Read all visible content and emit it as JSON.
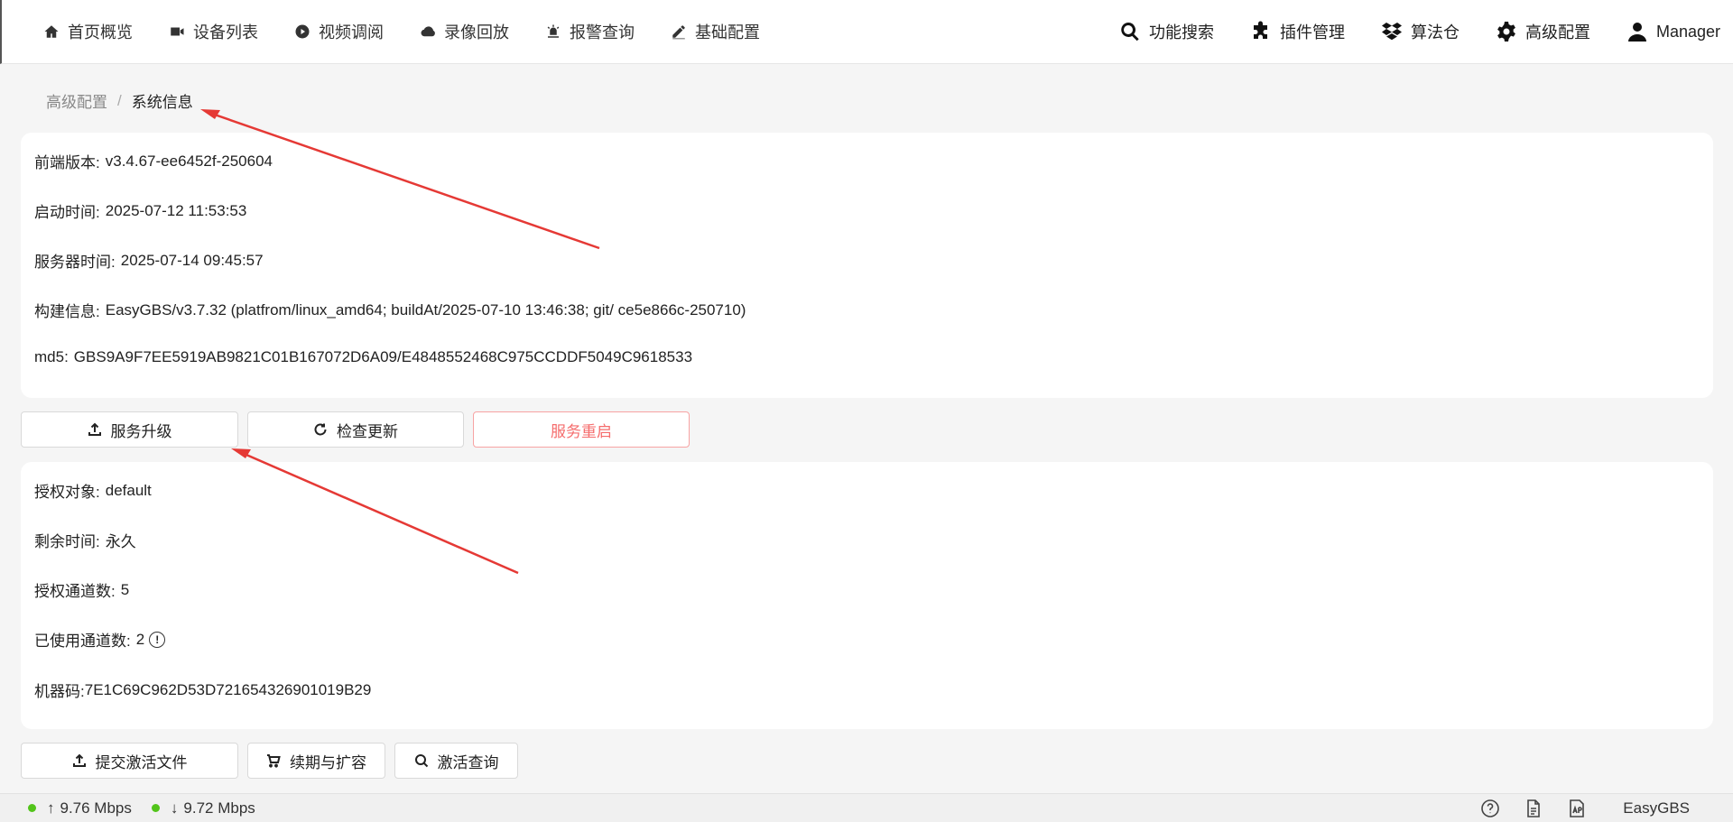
{
  "nav": {
    "left": [
      {
        "label": "首页概览",
        "icon": "home-icon"
      },
      {
        "label": "设备列表",
        "icon": "camera-icon"
      },
      {
        "label": "视频调阅",
        "icon": "play-icon"
      },
      {
        "label": "录像回放",
        "icon": "cloud-icon"
      },
      {
        "label": "报警查询",
        "icon": "alarm-icon"
      },
      {
        "label": "基础配置",
        "icon": "pen-icon"
      }
    ],
    "right": [
      {
        "label": "功能搜索",
        "icon": "search-icon"
      },
      {
        "label": "插件管理",
        "icon": "puzzle-icon"
      },
      {
        "label": "算法仓",
        "icon": "dropbox-icon"
      },
      {
        "label": "高级配置",
        "icon": "gear-icon"
      },
      {
        "label": "Manager",
        "icon": "user-icon"
      }
    ]
  },
  "breadcrumb": {
    "parent": "高级配置",
    "separator": "/",
    "current": "系统信息"
  },
  "system_info": {
    "frontend_version": {
      "label": "前端版本:",
      "value": "v3.4.67-ee6452f-250604"
    },
    "start_time": {
      "label": "启动时间:",
      "value": "2025-07-12 11:53:53"
    },
    "server_time": {
      "label": "服务器时间:",
      "value": "2025-07-14 09:45:57"
    },
    "build_info": {
      "label": "构建信息:",
      "value": "EasyGBS/v3.7.32 (platfrom/linux_amd64; buildAt/2025-07-10 13:46:38; git/ ce5e866c-250710)"
    },
    "md5": {
      "label": "md5:",
      "value": "GBS9A9F7EE5919AB9821C01B167072D6A09/E4848552468C975CCDDF5049C9618533"
    }
  },
  "service_buttons": {
    "upgrade": "服务升级",
    "check_update": "检查更新",
    "restart": "服务重启"
  },
  "license_info": {
    "target": {
      "label": "授权对象:",
      "value": "default"
    },
    "remaining": {
      "label": "剩余时间:",
      "value": "永久"
    },
    "channels": {
      "label": "授权通道数:",
      "value": "5"
    },
    "used_channels": {
      "label": "已使用通道数:",
      "value": "2"
    },
    "machine_code": {
      "label": "机器码:",
      "value": "7E1C69C962D53D721654326901019B29"
    }
  },
  "license_buttons": {
    "submit": "提交激活文件",
    "renew": "续期与扩容",
    "query": "激活查询"
  },
  "status": {
    "upload_arrow": "↑",
    "upload": "9.76 Mbps",
    "download_arrow": "↓",
    "download": "9.72 Mbps",
    "brand": "EasyGBS",
    "indicator_color": "#52c41a"
  },
  "colors": {
    "danger": "#f56c6c",
    "annotation": "#e53935"
  }
}
